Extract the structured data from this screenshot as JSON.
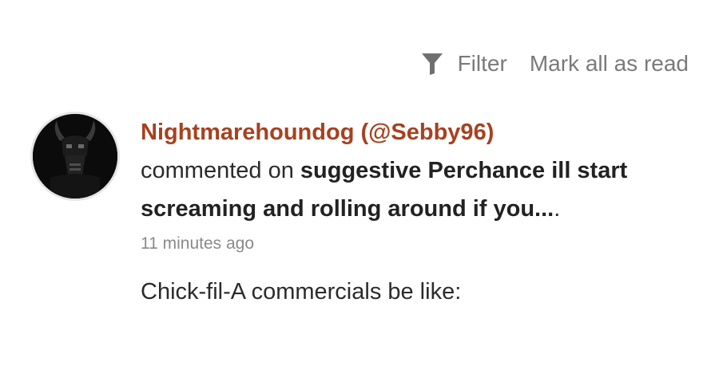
{
  "toolbar": {
    "filter_icon": "funnel-icon",
    "filter_label": "Filter",
    "mark_all_label": "Mark all as read"
  },
  "notification": {
    "avatar_icon": "horned-creature-avatar",
    "author": "Nightmarehoundog (@Sebby96)",
    "action": "commented on ",
    "post_title": "suggestive Perchance ill start screaming and rolling around if you...",
    "post_title_suffix": ".",
    "timestamp": "11 minutes ago",
    "comment": "Chick-fil-A commercials be like:"
  },
  "colors": {
    "author": "#a8411f",
    "muted": "#7a7a7a",
    "text": "#2b2b2b"
  }
}
